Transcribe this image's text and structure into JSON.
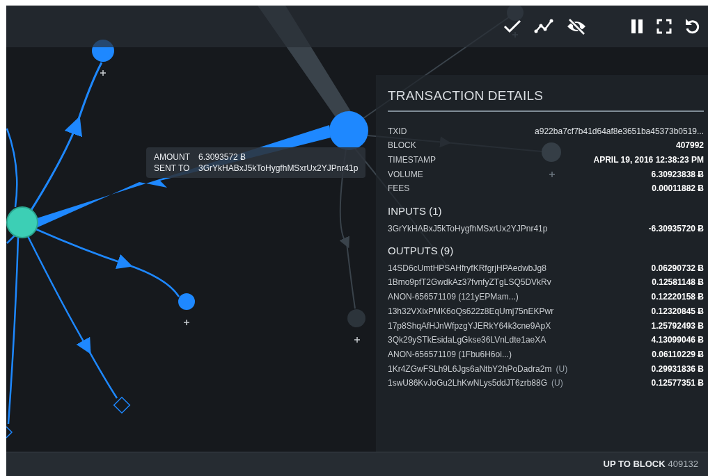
{
  "tooltip": {
    "rows": [
      {
        "label": "AMOUNT",
        "value": "6.3093572 Ƀ"
      },
      {
        "label": "SENT TO",
        "value": "3GrYkHABxJ5kToHygfhMSxrUx2YJPnr41p"
      }
    ]
  },
  "details": {
    "title": "TRANSACTION DETAILS",
    "fields": [
      {
        "label": "TXID",
        "value": "a922ba7cf7b41d64af8e3651ba45373b0519..."
      },
      {
        "label": "BLOCK",
        "value": "407992"
      },
      {
        "label": "TIMESTAMP",
        "value": "APRIL 19, 2016 12:38:23 PM"
      },
      {
        "label": "VOLUME",
        "value": "6.30923838 Ƀ"
      },
      {
        "label": "FEES",
        "value": "0.00011882 Ƀ"
      }
    ],
    "inputs": {
      "heading": "INPUTS (1)",
      "rows": [
        {
          "address": "3GrYkHABxJ5kToHygfhMSxrUx2YJPnr41p",
          "amount": "-6.30935720 Ƀ"
        }
      ]
    },
    "outputs": {
      "heading": "OUTPUTS (9)",
      "rows": [
        {
          "address": "14SD6cUmtHPSAHfryfKRfgrjHPAedwbJg8",
          "amount": "0.06290732 Ƀ"
        },
        {
          "address": "1Bmo9pfT2GwdkAz37fvnfyZTgLSQ5DVkRv",
          "amount": "0.12581148 Ƀ"
        },
        {
          "address": "ANON-656571109 (121yEPMam...)",
          "amount": "0.12220158 Ƀ"
        },
        {
          "address": "13h32VXixPMK6oQs622z8EqUmj75nEKPwr",
          "amount": "0.12320845 Ƀ"
        },
        {
          "address": "17p8ShqAfHJnWfpzgYJERkY64k3cne9ApX",
          "amount": "1.25792493 Ƀ"
        },
        {
          "address": "3Qk29ySTkEsidaLgGkse36LVnLdte1aeXA",
          "amount": "4.13099046 Ƀ"
        },
        {
          "address": "ANON-656571109 (1Fbu6H6oi...)",
          "amount": "0.06110229 Ƀ"
        },
        {
          "address": "1Kr4ZGwFSLh9L6Jgs6aNtbY2hPoDadra2m",
          "tag": "(U)",
          "amount": "0.29931836 Ƀ"
        },
        {
          "address": "1swU86KvJoGu2LhKwNLys5ddJT6zrb88G",
          "tag": "(U)",
          "amount": "0.12577351 Ƀ"
        }
      ]
    }
  },
  "status_bar": {
    "label": "UP TO BLOCK",
    "value": "409132"
  }
}
